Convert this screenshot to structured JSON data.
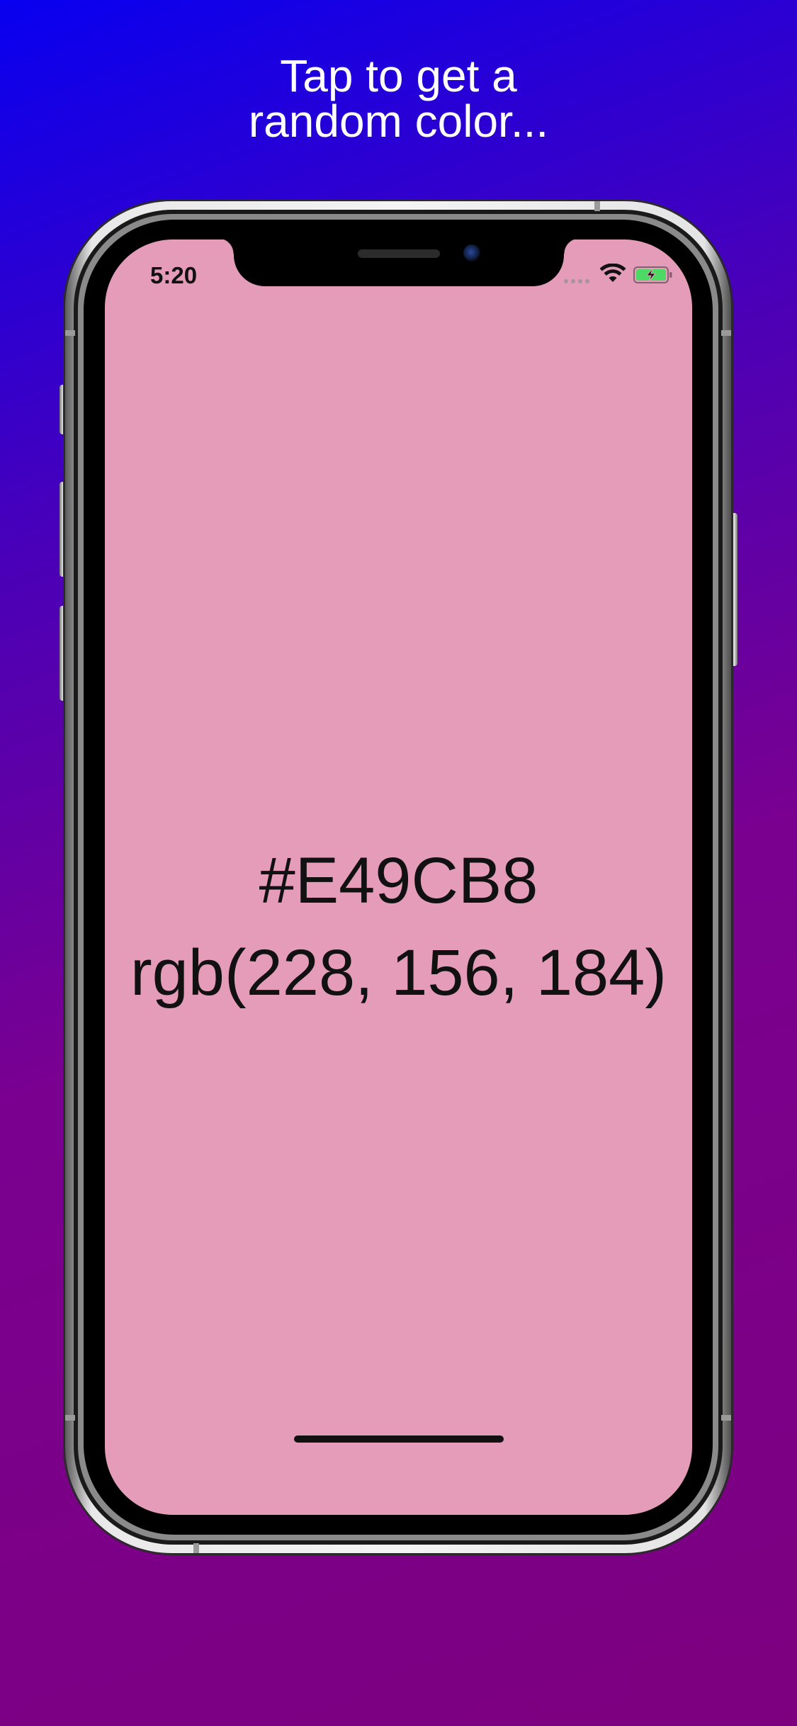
{
  "headline": {
    "line1": "Tap to get a",
    "line2": "random color..."
  },
  "status_bar": {
    "time": "5:20",
    "icons": [
      "signal-dots-icon",
      "wifi-icon",
      "battery-charging-icon"
    ]
  },
  "color": {
    "hex": "#E49CB8",
    "rgb": "rgb(228, 156, 184)",
    "background": "#E49CB8"
  },
  "colors": {
    "gradient_start": "#0800F0",
    "gradient_end": "#7D007F",
    "headline_text": "#FFFFFF",
    "battery_fill": "#4CD964"
  }
}
